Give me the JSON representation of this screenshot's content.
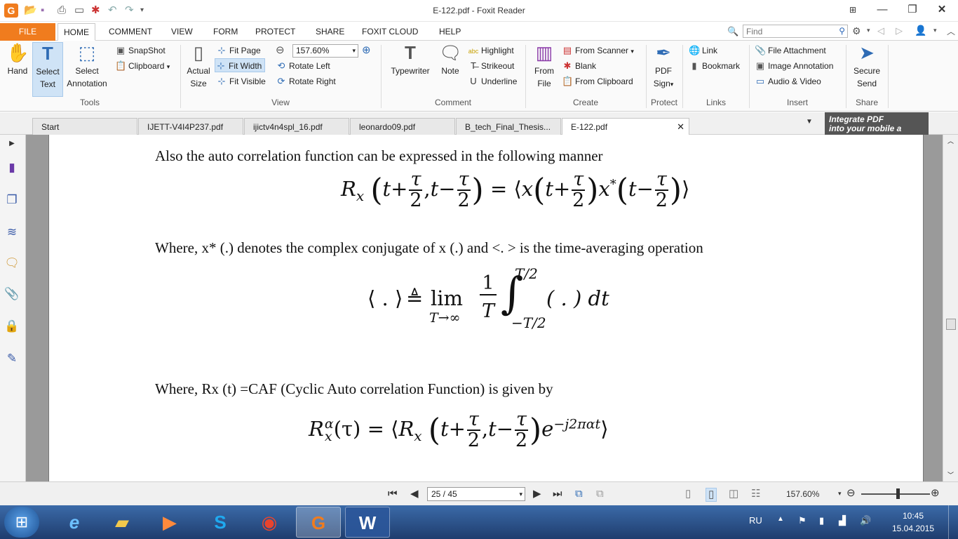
{
  "window": {
    "title": "E-122.pdf - Foxit Reader"
  },
  "menu": {
    "file": "FILE",
    "items": [
      "HOME",
      "COMMENT",
      "VIEW",
      "FORM",
      "PROTECT",
      "SHARE",
      "FOXIT CLOUD",
      "HELP"
    ],
    "find_placeholder": "Find"
  },
  "ribbon": {
    "tools": {
      "hand": "Hand",
      "select_text_1": "Select",
      "select_text_2": "Text",
      "select_annotation_1": "Select",
      "select_annotation_2": "Annotation",
      "snapshot": "SnapShot",
      "clipboard": "Clipboard",
      "label": "Tools"
    },
    "view": {
      "actual_size_1": "Actual",
      "actual_size_2": "Size",
      "fit_page": "Fit Page",
      "fit_width": "Fit Width",
      "fit_visible": "Fit Visible",
      "zoom": "157.60%",
      "rotate_left": "Rotate Left",
      "rotate_right": "Rotate Right",
      "label": "View"
    },
    "comment": {
      "typewriter": "Typewriter",
      "note": "Note",
      "highlight": "Highlight",
      "strikeout": "Strikeout",
      "underline": "Underline",
      "label": "Comment"
    },
    "create": {
      "from_file_1": "From",
      "from_file_2": "File",
      "from_scanner": "From Scanner",
      "blank": "Blank",
      "from_clipboard": "From Clipboard",
      "label": "Create"
    },
    "protect": {
      "pdf_sign_1": "PDF",
      "pdf_sign_2": "Sign",
      "label": "Protect"
    },
    "links": {
      "link": "Link",
      "bookmark": "Bookmark",
      "label": "Links"
    },
    "insert": {
      "file_attachment": "File Attachment",
      "image_annotation": "Image Annotation",
      "audio_video": "Audio & Video",
      "label": "Insert"
    },
    "share": {
      "secure_send_1": "Secure",
      "secure_send_2": "Send",
      "label": "Share"
    }
  },
  "tabs": [
    {
      "label": "Start"
    },
    {
      "label": "IJETT-V4I4P237.pdf"
    },
    {
      "label": "ijictv4n4spl_16.pdf"
    },
    {
      "label": "leonardo09.pdf"
    },
    {
      "label": "B_tech_Final_Thesis..."
    },
    {
      "label": "E-122.pdf"
    }
  ],
  "ad_banner": {
    "line1": "Integrate PDF",
    "line2": "into your mobile a"
  },
  "document": {
    "line1": "Also the auto correlation function can be expressed in the following manner",
    "line2": "Where, x* (.) denotes the complex conjugate of x (.) and <. > is the time-averaging operation",
    "line3": "Where,  Rx (t) =CAF (Cyclic Auto correlation Function) is given by",
    "eq1": {
      "lhs": "R",
      "sub": "x",
      "t": "t",
      "plus": "+",
      "minus": "−",
      "tau": "τ",
      "two": "2",
      "comma": ",",
      "eq": "=",
      "langle": "⟨",
      "rangle": "⟩",
      "x": "x",
      "star": "*"
    },
    "eq2": {
      "lhs": "⟨ . ⟩",
      "defeq": "≜",
      "lim": "lim",
      "limsub": "T→∞",
      "one": "1",
      "T": "T",
      "int": "∫",
      "upper": "T/2",
      "lower": "−T/2",
      "body": "( . ) dt"
    },
    "eq3": {
      "R": "R",
      "sup": "α",
      "sub": "x",
      "arg": "(τ)",
      "eq": "=",
      "langle": "⟨",
      "exp": "e",
      "expsup": "−j2παt",
      "rangle": "⟩"
    }
  },
  "status": {
    "page": "25 / 45",
    "zoom": "157.60%"
  },
  "taskbar": {
    "lang": "RU",
    "time": "10:45",
    "date": "15.04.2015"
  }
}
